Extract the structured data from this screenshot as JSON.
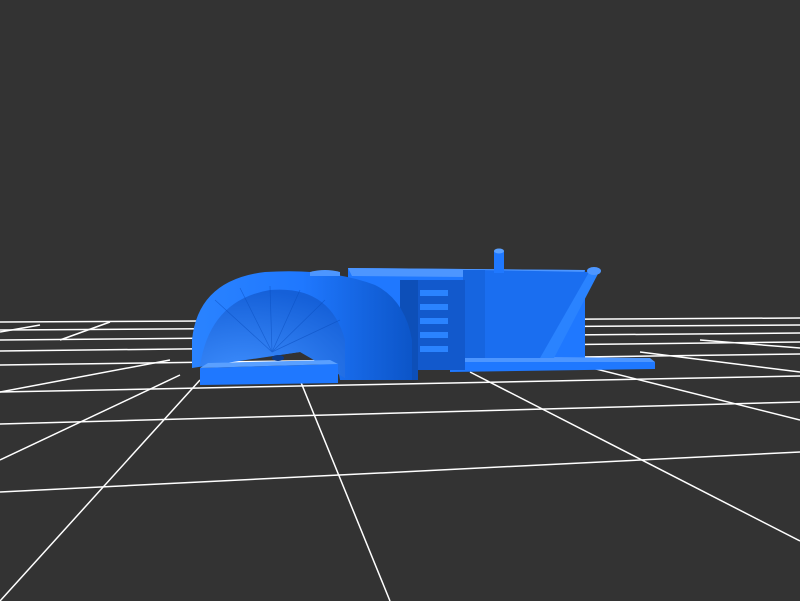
{
  "scene": {
    "background_color": "#333333",
    "grid_color": "#ffffff",
    "model_color": "#1f78ff",
    "model_shadow_color": "#0b4fc0",
    "model_highlight_color": "#4d96ff"
  },
  "model": {
    "icon": "3d-model"
  }
}
